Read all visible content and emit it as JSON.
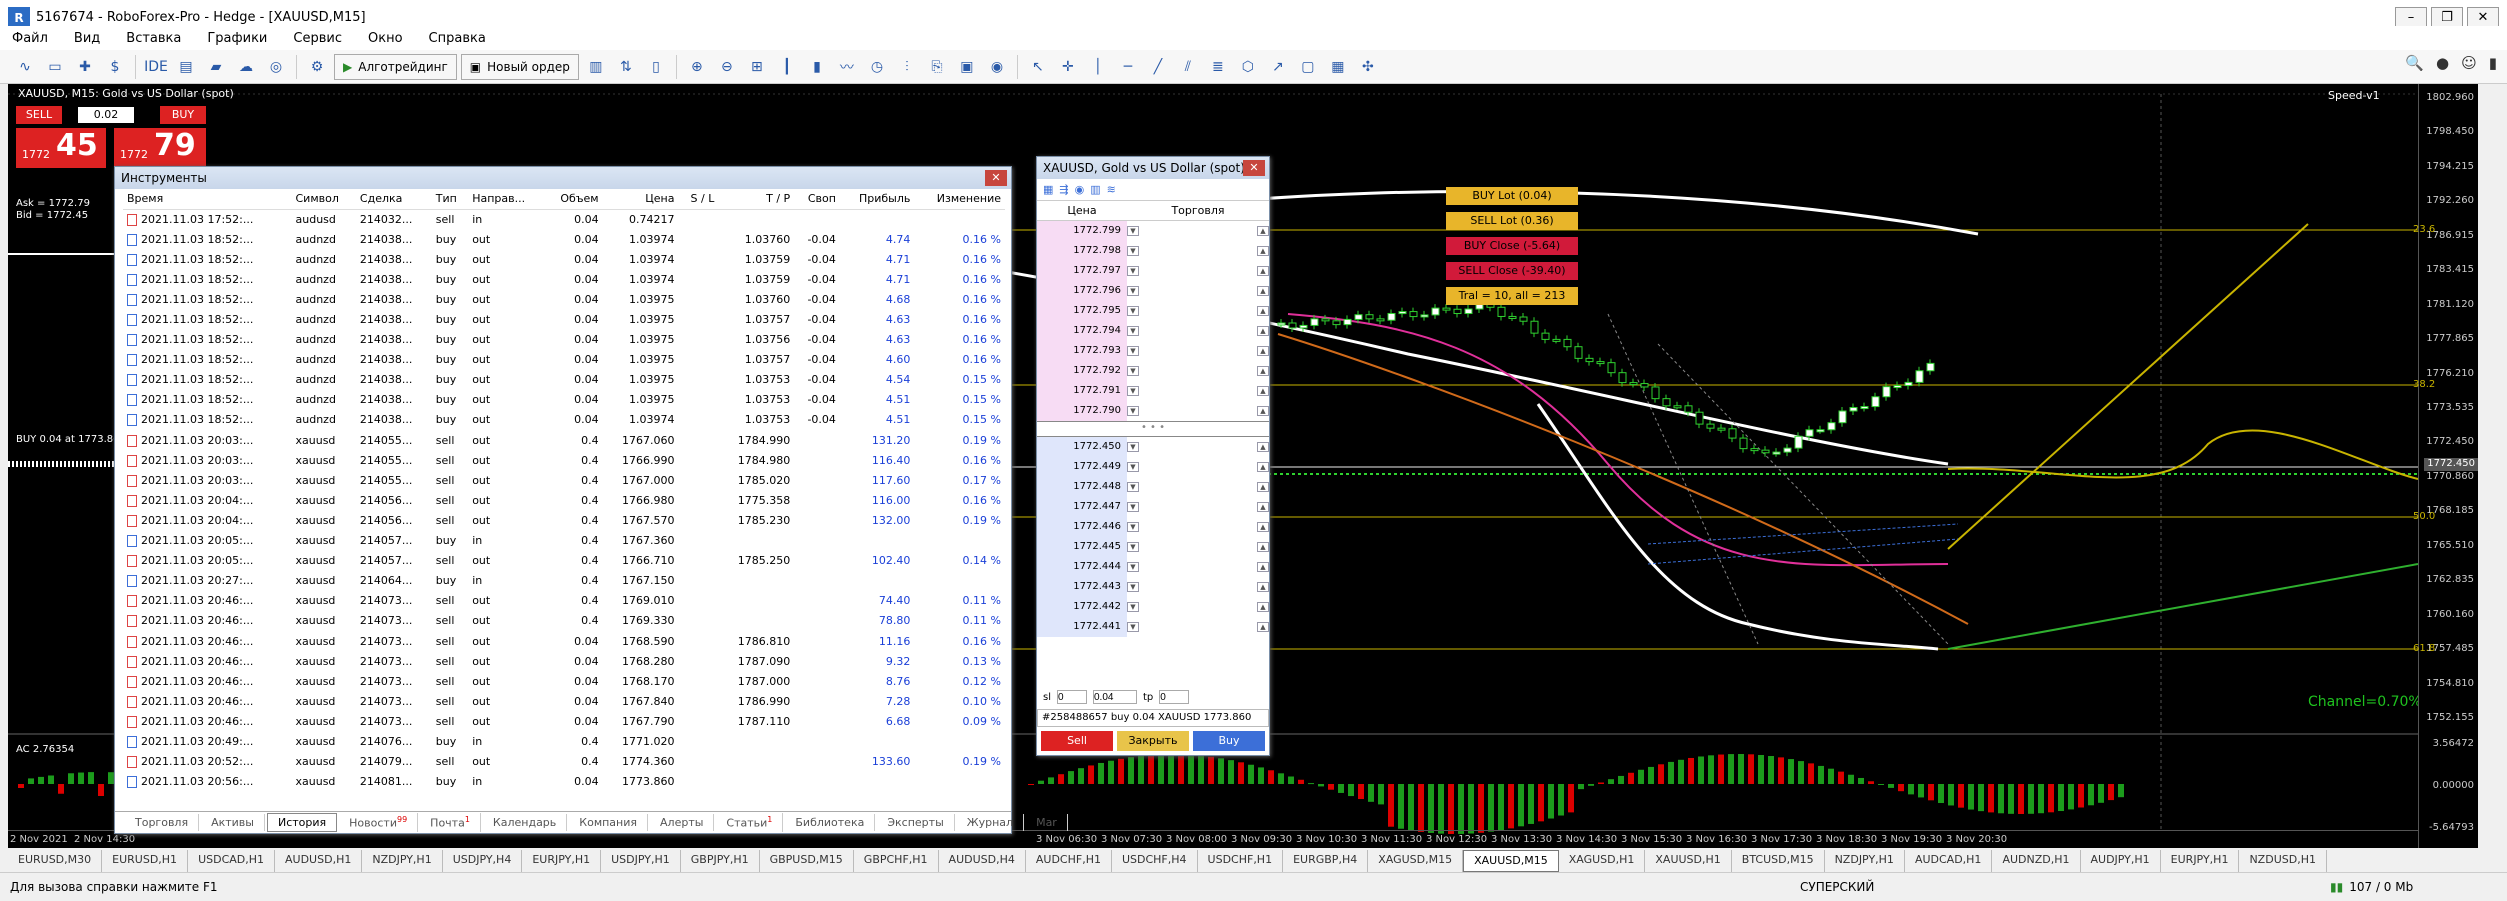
{
  "window": {
    "title": "5167674 - RoboForex-Pro - Hedge - [XAUUSD,M15]"
  },
  "menu": [
    "Файл",
    "Вид",
    "Вставка",
    "Графики",
    "Сервис",
    "Окно",
    "Справка"
  ],
  "toolbar": {
    "algo": "Алготрейдинг",
    "neworder": "Новый ордер"
  },
  "chart": {
    "symbol_label": "XAUUSD, M15:  Gold vs US Dollar (spot)",
    "speed_label": "Speed-v1",
    "trade": {
      "sell": "SELL",
      "buy": "BUY",
      "volume": "0.02",
      "sell_small": "1772",
      "sell_big": "45",
      "sell_sup": "0",
      "buy_small": "1772",
      "buy_big": "79",
      "buy_sup": "0"
    },
    "ask": "Ask = 1772.79",
    "bid": "Bid = 1772.45",
    "buyline": "BUY 0.04 at 1773.860",
    "ac": "AC 2.76354",
    "buttons": {
      "buylot": "BUY Lot (0.04)",
      "selllot": "SELL Lot (0.36)",
      "buyclose": "BUY Close (-5.64)",
      "sellclose": "SELL Close (-39.40)",
      "tral": "Tral = 10, all = 213"
    },
    "channel": "Channel=0.70%",
    "prices": [
      "1802.960",
      "1798.450",
      "1794.215",
      "1792.260",
      "1786.915",
      "1783.415",
      "1781.120",
      "1777.865",
      "1776.210",
      "1773.535",
      "1772.450",
      "1770.860",
      "1768.185",
      "1765.510",
      "1762.835",
      "1760.160",
      "1757.485",
      "1754.810",
      "1752.155",
      "3.56472",
      "0.00000",
      "-5.64793"
    ],
    "levels": [
      "23.6",
      "38.2",
      "50.0",
      "61.8"
    ],
    "times": [
      "2 Nov 2021",
      "2 Nov 14:30",
      "3 Nov 06:30",
      "3 Nov 07:30",
      "3 Nov 08:00",
      "3 Nov 09:30",
      "3 Nov 10:30",
      "3 Nov 11:30",
      "3 Nov 12:30",
      "3 Nov 13:30",
      "3 Nov 14:30",
      "3 Nov 15:30",
      "3 Nov 16:30",
      "3 Nov 17:30",
      "3 Nov 18:30",
      "3 Nov 19:30",
      "3 Nov 20:30"
    ]
  },
  "instruments": {
    "title": "Инструменты",
    "headers": [
      "Время",
      "Символ",
      "Сделка",
      "Тип",
      "Направ...",
      "Объем",
      "Цена",
      "S / L",
      "T / P",
      "Своп",
      "Прибыль",
      "Изменение"
    ],
    "rows": [
      [
        "2021.11.03 17:52:...",
        "audusd",
        "214032...",
        "sell",
        "in",
        "0.04",
        "0.74217",
        "",
        "",
        "",
        "",
        ""
      ],
      [
        "2021.11.03 18:52:...",
        "audnzd",
        "214038...",
        "buy",
        "out",
        "0.04",
        "1.03974",
        "",
        "1.03760",
        "-0.04",
        "4.74",
        "0.16 %"
      ],
      [
        "2021.11.03 18:52:...",
        "audnzd",
        "214038...",
        "buy",
        "out",
        "0.04",
        "1.03974",
        "",
        "1.03759",
        "-0.04",
        "4.71",
        "0.16 %"
      ],
      [
        "2021.11.03 18:52:...",
        "audnzd",
        "214038...",
        "buy",
        "out",
        "0.04",
        "1.03974",
        "",
        "1.03759",
        "-0.04",
        "4.71",
        "0.16 %"
      ],
      [
        "2021.11.03 18:52:...",
        "audnzd",
        "214038...",
        "buy",
        "out",
        "0.04",
        "1.03975",
        "",
        "1.03760",
        "-0.04",
        "4.68",
        "0.16 %"
      ],
      [
        "2021.11.03 18:52:...",
        "audnzd",
        "214038...",
        "buy",
        "out",
        "0.04",
        "1.03975",
        "",
        "1.03757",
        "-0.04",
        "4.63",
        "0.16 %"
      ],
      [
        "2021.11.03 18:52:...",
        "audnzd",
        "214038...",
        "buy",
        "out",
        "0.04",
        "1.03975",
        "",
        "1.03756",
        "-0.04",
        "4.63",
        "0.16 %"
      ],
      [
        "2021.11.03 18:52:...",
        "audnzd",
        "214038...",
        "buy",
        "out",
        "0.04",
        "1.03975",
        "",
        "1.03757",
        "-0.04",
        "4.60",
        "0.16 %"
      ],
      [
        "2021.11.03 18:52:...",
        "audnzd",
        "214038...",
        "buy",
        "out",
        "0.04",
        "1.03975",
        "",
        "1.03753",
        "-0.04",
        "4.54",
        "0.15 %"
      ],
      [
        "2021.11.03 18:52:...",
        "audnzd",
        "214038...",
        "buy",
        "out",
        "0.04",
        "1.03975",
        "",
        "1.03753",
        "-0.04",
        "4.51",
        "0.15 %"
      ],
      [
        "2021.11.03 18:52:...",
        "audnzd",
        "214038...",
        "buy",
        "out",
        "0.04",
        "1.03974",
        "",
        "1.03753",
        "-0.04",
        "4.51",
        "0.15 %"
      ],
      [
        "2021.11.03 20:03:...",
        "xauusd",
        "214055...",
        "sell",
        "out",
        "0.4",
        "1767.060",
        "",
        "1784.990",
        "",
        "131.20",
        "0.19 %"
      ],
      [
        "2021.11.03 20:03:...",
        "xauusd",
        "214055...",
        "sell",
        "out",
        "0.4",
        "1766.990",
        "",
        "1784.980",
        "",
        "116.40",
        "0.16 %"
      ],
      [
        "2021.11.03 20:03:...",
        "xauusd",
        "214055...",
        "sell",
        "out",
        "0.4",
        "1767.000",
        "",
        "1785.020",
        "",
        "117.60",
        "0.17 %"
      ],
      [
        "2021.11.03 20:04:...",
        "xauusd",
        "214056...",
        "sell",
        "out",
        "0.4",
        "1766.980",
        "",
        "1775.358",
        "",
        "116.00",
        "0.16 %"
      ],
      [
        "2021.11.03 20:04:...",
        "xauusd",
        "214056...",
        "sell",
        "out",
        "0.4",
        "1767.570",
        "",
        "1785.230",
        "",
        "132.00",
        "0.19 %"
      ],
      [
        "2021.11.03 20:05:...",
        "xauusd",
        "214057...",
        "buy",
        "in",
        "0.4",
        "1767.360",
        "",
        "",
        "",
        "",
        ""
      ],
      [
        "2021.11.03 20:05:...",
        "xauusd",
        "214057...",
        "sell",
        "out",
        "0.4",
        "1766.710",
        "",
        "1785.250",
        "",
        "102.40",
        "0.14 %"
      ],
      [
        "2021.11.03 20:27:...",
        "xauusd",
        "214064...",
        "buy",
        "in",
        "0.4",
        "1767.150",
        "",
        "",
        "",
        "",
        ""
      ],
      [
        "2021.11.03 20:46:...",
        "xauusd",
        "214073...",
        "sell",
        "out",
        "0.4",
        "1769.010",
        "",
        "",
        "",
        "74.40",
        "0.11 %"
      ],
      [
        "2021.11.03 20:46:...",
        "xauusd",
        "214073...",
        "sell",
        "out",
        "0.4",
        "1769.330",
        "",
        "",
        "",
        "78.80",
        "0.11 %"
      ],
      [
        "2021.11.03 20:46:...",
        "xauusd",
        "214073...",
        "sell",
        "out",
        "0.04",
        "1768.590",
        "",
        "1786.810",
        "",
        "11.16",
        "0.16 %"
      ],
      [
        "2021.11.03 20:46:...",
        "xauusd",
        "214073...",
        "sell",
        "out",
        "0.04",
        "1768.280",
        "",
        "1787.090",
        "",
        "9.32",
        "0.13 %"
      ],
      [
        "2021.11.03 20:46:...",
        "xauusd",
        "214073...",
        "sell",
        "out",
        "0.04",
        "1768.170",
        "",
        "1787.000",
        "",
        "8.76",
        "0.12 %"
      ],
      [
        "2021.11.03 20:46:...",
        "xauusd",
        "214073...",
        "sell",
        "out",
        "0.04",
        "1767.840",
        "",
        "1786.990",
        "",
        "7.28",
        "0.10 %"
      ],
      [
        "2021.11.03 20:46:...",
        "xauusd",
        "214073...",
        "sell",
        "out",
        "0.04",
        "1767.790",
        "",
        "1787.110",
        "",
        "6.68",
        "0.09 %"
      ],
      [
        "2021.11.03 20:49:...",
        "xauusd",
        "214076...",
        "buy",
        "in",
        "0.4",
        "1771.020",
        "",
        "",
        "",
        "",
        ""
      ],
      [
        "2021.11.03 20:52:...",
        "xauusd",
        "214079...",
        "sell",
        "out",
        "0.4",
        "1774.360",
        "",
        "",
        "",
        "133.60",
        "0.19 %"
      ],
      [
        "2021.11.03 20:56:...",
        "xauusd",
        "214081...",
        "buy",
        "in",
        "0.04",
        "1773.860",
        "",
        "",
        "",
        "",
        ""
      ]
    ],
    "tabs": [
      "Торговля",
      "Активы",
      "История",
      "Новости",
      "Почта",
      "Календарь",
      "Компания",
      "Алерты",
      "Статьи",
      "Библиотека",
      "Эксперты",
      "Журнал",
      "Mar"
    ],
    "news_badge": "99",
    "mail_badge": "1",
    "articles_badge": "1"
  },
  "dom": {
    "title": "XAUUSD, Gold vs US Dollar (spot)",
    "col_price": "Цена",
    "col_trade": "Торговля",
    "ask_prices": [
      "1772.799",
      "1772.798",
      "1772.797",
      "1772.796",
      "1772.795",
      "1772.794",
      "1772.793",
      "1772.792",
      "1772.791",
      "1772.790"
    ],
    "bid_prices": [
      "1772.450",
      "1772.449",
      "1772.448",
      "1772.447",
      "1772.446",
      "1772.445",
      "1772.444",
      "1772.443",
      "1772.442",
      "1772.441"
    ],
    "sl_label": "sl",
    "sl": "0",
    "vol": "0.04",
    "tp_label": "tp",
    "tp": "0",
    "position": "#258488657 buy 0.04 XAUUSD 1773.860",
    "sell": "Sell",
    "close": "Закрыть",
    "buy": "Buy"
  },
  "symtabs": [
    "EURUSD,M30",
    "EURUSD,H1",
    "USDCAD,H1",
    "AUDUSD,H1",
    "NZDJPY,H1",
    "USDJPY,H4",
    "EURJPY,H1",
    "USDJPY,H1",
    "GBPJPY,H1",
    "GBPUSD,M15",
    "GBPCHF,H1",
    "AUDUSD,H4",
    "AUDCHF,H1",
    "USDCHF,H4",
    "USDCHF,H1",
    "EURGBP,H4",
    "XAGUSD,M15",
    "XAUUSD,M15",
    "XAGUSD,H1",
    "XAUUSD,H1",
    "BTCUSD,M15",
    "NZDJPY,H1",
    "AUDCAD,H1",
    "AUDNZD,H1",
    "AUDJPY,H1",
    "EURJPY,H1",
    "NZDUSD,H1"
  ],
  "active_symtab": "XAUUSD,M15",
  "status": {
    "help": "Для вызова справки нажмите F1",
    "profile": "СУПЕРСКИЙ",
    "traffic": "107 / 0 Mb"
  }
}
